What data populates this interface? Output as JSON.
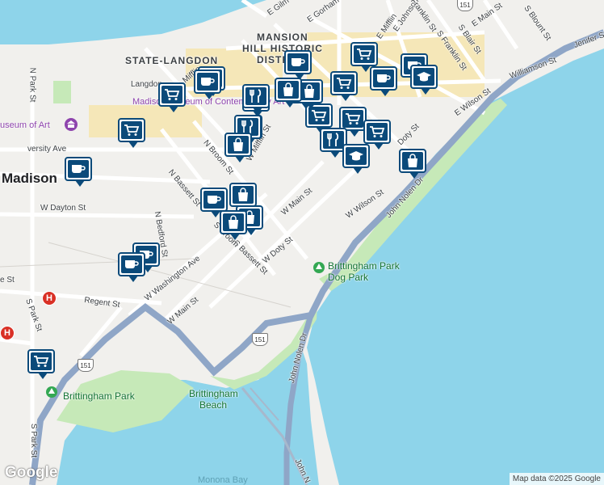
{
  "city_label": "Madison",
  "district_labels": [
    "MANSION",
    "HILL HISTORIC",
    "DISTR",
    "STATE-LANGDON"
  ],
  "street_labels": [
    "E Gilm",
    "E Gorham",
    "E Mifflin",
    "E Johnson",
    "Franklin St",
    "E Main St",
    "S Blount St",
    "S Blair St",
    "Jenifer St",
    "S Franklin St",
    "Williamson St",
    "E Wilson St",
    "Langdon",
    "Mifflin",
    "W Mifflin St",
    "N Broom St",
    "N Bassett St",
    "W Main St",
    "W Doty St",
    "Doty St",
    "W Wilson St",
    "John Nolen Dr",
    "W Dayton St",
    "N Park St",
    "N Bedford St",
    "W Washington Ave",
    "S Bassett St",
    "Regent St",
    "W Main St",
    "S Park St",
    "S Park St",
    "John Nolen Dr",
    "John N",
    "versity Ave",
    "e St",
    "S Broom"
  ],
  "poi_labels": [
    "Madison Museum of Contemporary Art",
    "useum of Art",
    "Brittingham Park Dog Park",
    "Brittingham Park",
    "Brittingham Beach",
    "Monona Bay"
  ],
  "route_shields": [
    "151",
    "151",
    "151"
  ],
  "hospital_symbol": "H",
  "google_logo": "Google",
  "attribution": "Map data ©2025 Google",
  "markers": [
    "grocery",
    "grocery",
    "grocery",
    "grocery",
    "grocery",
    "grocery",
    "grocery",
    "grocery",
    "grocery",
    "grocery",
    "grocery",
    "grocery",
    "cafe",
    "cafe",
    "cafe",
    "cafe",
    "cafe",
    "cafe",
    "cafe",
    "cafe",
    "restaurant",
    "restaurant",
    "restaurant",
    "shopping",
    "shopping",
    "shopping",
    "shopping",
    "shopping",
    "shopping",
    "shopping",
    "school",
    "school"
  ],
  "colors": {
    "water": "#8ed4ea",
    "land": "#f1f0ed",
    "park": "#c6e9b8",
    "highway": "#8fa6c7",
    "marker": "#0b4a7a"
  }
}
